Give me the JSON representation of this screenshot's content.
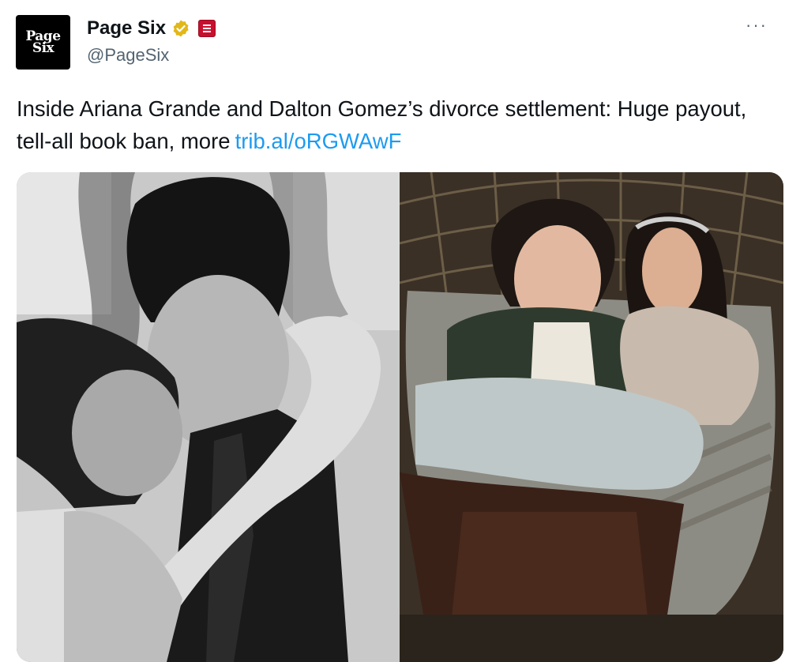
{
  "account": {
    "avatar_line1": "Page",
    "avatar_line2": "Six",
    "name": "Page Six",
    "handle": "@PageSix",
    "verified_icon": "gold-verified-badge-icon",
    "affiliation_icon": "new-york-post-badge-icon"
  },
  "menu": {
    "more_label": "···"
  },
  "tweet": {
    "text": "Inside Ariana Grande and Dalton Gomez’s divorce settlement: Huge payout, tell-all book ban, more",
    "link": "trib.al/oRGWAwF"
  },
  "colors": {
    "link": "#1d9bf0",
    "secondary_text": "#536471",
    "verified_gold": "#e2b719",
    "affiliation_red": "#c8102e"
  }
}
